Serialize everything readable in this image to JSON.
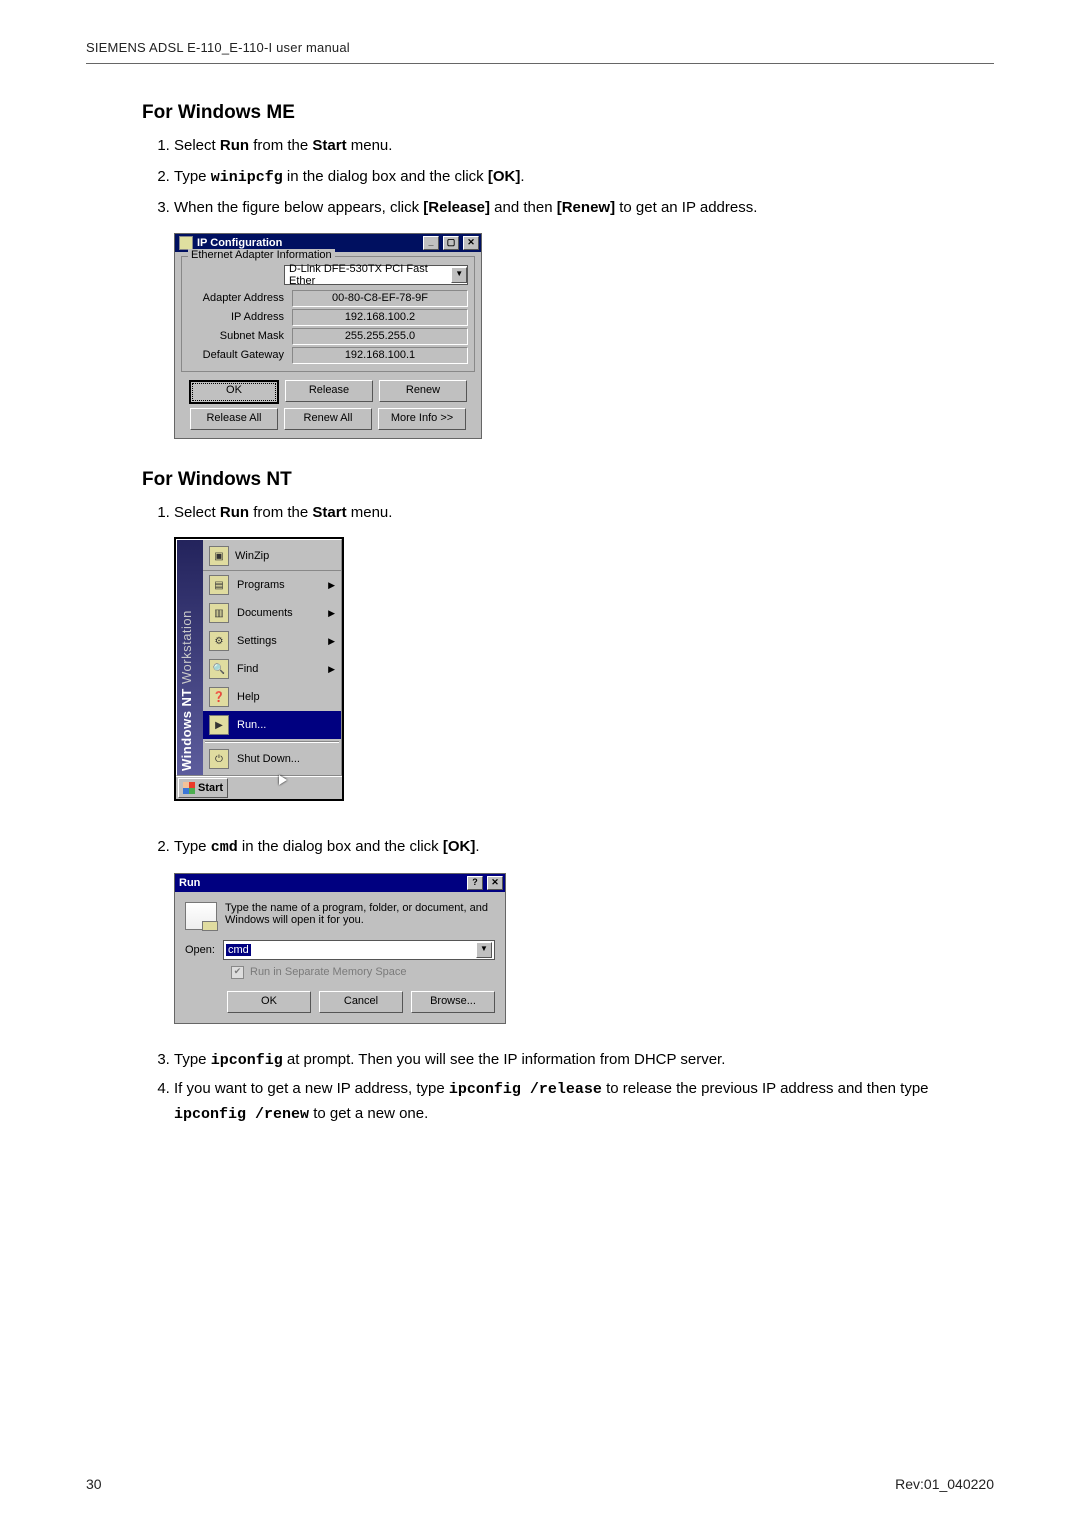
{
  "page": {
    "running_head": "SIEMENS ADSL E-110_E-110-I user manual",
    "footer_left": "30",
    "footer_right": "Rev:01_040220"
  },
  "section_me": {
    "title": "For Windows ME",
    "step1_a": "Select ",
    "step1_run": "Run",
    "step1_b": " from the ",
    "step1_start": "Start",
    "step1_c": " menu.",
    "step2_a": "Type ",
    "step2_cmd": "winipcfg",
    "step2_b": " in the dialog box and the click ",
    "step2_ok": "[OK]",
    "step2_c": ".",
    "step3_a": "When the figure below appears, click ",
    "step3_rel": "[Release]",
    "step3_b": " and then ",
    "step3_ren": "[Renew]",
    "step3_c": " to get an IP address."
  },
  "ipcfg": {
    "title": "IP Configuration",
    "group": "Ethernet Adapter Information",
    "adapter": "D-Link DFE-530TX PCI Fast Ether",
    "rows": [
      {
        "label": "Adapter Address",
        "value": "00-80-C8-EF-78-9F"
      },
      {
        "label": "IP Address",
        "value": "192.168.100.2"
      },
      {
        "label": "Subnet Mask",
        "value": "255.255.255.0"
      },
      {
        "label": "Default Gateway",
        "value": "192.168.100.1"
      }
    ],
    "btn_ok": "OK",
    "btn_release": "Release",
    "btn_renew": "Renew",
    "btn_release_all": "Release All",
    "btn_renew_all": "Renew All",
    "btn_more": "More Info >>"
  },
  "section_nt": {
    "title": "For Windows NT",
    "step1_a": "Select ",
    "step1_run": "Run",
    "step1_b": " from the ",
    "step1_start": "Start",
    "step1_c": " menu.",
    "step2_a": "Type ",
    "step2_cmd": "cmd",
    "step2_b": " in the dialog box and the click ",
    "step2_ok": "[OK]",
    "step2_c": ".",
    "step3_a": "Type ",
    "step3_cmd": "ipconfig",
    "step3_b": " at prompt. Then you will see the IP information from DHCP server.",
    "step4_a": "If you want to get a new IP address, type ",
    "step4_cmd1": "ipconfig /release",
    "step4_b": " to release the previous IP address and then type ",
    "step4_cmd2": "ipconfig /renew",
    "step4_c": " to get a new one."
  },
  "startmenu": {
    "side_bold": "Windows NT",
    "side_light": " Workstation",
    "top_item": "WinZip",
    "items": [
      {
        "label": "Programs",
        "arrow": true
      },
      {
        "label": "Documents",
        "arrow": true
      },
      {
        "label": "Settings",
        "arrow": true
      },
      {
        "label": "Find",
        "arrow": true
      },
      {
        "label": "Help",
        "arrow": false
      },
      {
        "label": "Run...",
        "arrow": false,
        "highlight": true
      },
      {
        "sep": true
      },
      {
        "label": "Shut Down...",
        "arrow": false
      }
    ],
    "start_label": "Start"
  },
  "rundlg": {
    "title": "Run",
    "desc": "Type the name of a program, folder, or document, and Windows will open it for you.",
    "open_label": "Open:",
    "value": "cmd",
    "checkbox": "Run in Separate Memory Space",
    "btn_ok": "OK",
    "btn_cancel": "Cancel",
    "btn_browse": "Browse..."
  }
}
